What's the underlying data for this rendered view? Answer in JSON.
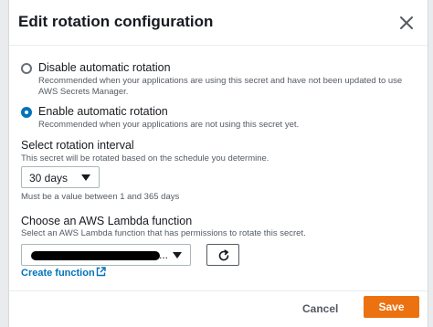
{
  "dialog": {
    "title": "Edit rotation configuration",
    "close_icon": "close-icon"
  },
  "rotation": {
    "disable": {
      "label": "Disable automatic rotation",
      "description": "Recommended when your applications are using this secret and have not been updated to use AWS Secrets Manager.",
      "selected": false
    },
    "enable": {
      "label": "Enable automatic rotation",
      "description": "Recommended when your applications are not using this secret yet.",
      "selected": true
    }
  },
  "interval": {
    "label": "Select rotation interval",
    "description": "This secret will be rotated based on the schedule you determine.",
    "value": "30 days",
    "constraint": "Must be a value between 1 and 365 days"
  },
  "lambda": {
    "label": "Choose an AWS Lambda function",
    "description": "Select an AWS Lambda function that has permissions to rotate this secret.",
    "value_suffix": "...",
    "refresh_icon": "refresh-icon",
    "create_link": "Create function",
    "external_icon": "external-link-icon"
  },
  "footer": {
    "cancel": "Cancel",
    "save": "Save"
  },
  "colors": {
    "accent": "#0073bb",
    "primary_button": "#ec7211",
    "text": "#16191f",
    "muted": "#545b64"
  }
}
